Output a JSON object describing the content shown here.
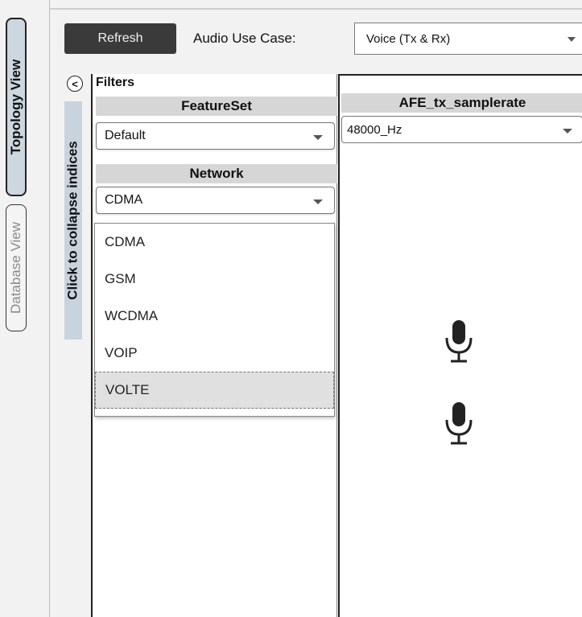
{
  "tabs": {
    "topology_view": "Topology View",
    "database_view": "Database View"
  },
  "toolbar": {
    "refresh_label": "Refresh",
    "use_case_label": "Audio Use Case:",
    "use_case_value": "Voice (Tx & Rx)"
  },
  "collapse": {
    "button_glyph": "<",
    "strip_label": "Click to collapse indices"
  },
  "filters": {
    "title": "Filters",
    "featureset": {
      "header": "FeatureSet",
      "value": "Default"
    },
    "network": {
      "header": "Network",
      "value": "CDMA",
      "options": [
        "CDMA",
        "GSM",
        "WCDMA",
        "VOIP",
        "VOLTE"
      ],
      "highlighted_option": "VOLTE"
    }
  },
  "afe_tx": {
    "header": "AFE_tx_samplerate",
    "value": "48000_Hz"
  },
  "icons": {
    "collapse": "chevron-left-icon",
    "dropdown": "caret-down-icon",
    "microphone": "microphone-icon"
  },
  "colors": {
    "active_tab_bg": "#ccd7df",
    "refresh_bg": "#3a3a3a",
    "section_header_bg": "#d6d6d6",
    "collapse_strip_bg": "#c9d3de"
  }
}
